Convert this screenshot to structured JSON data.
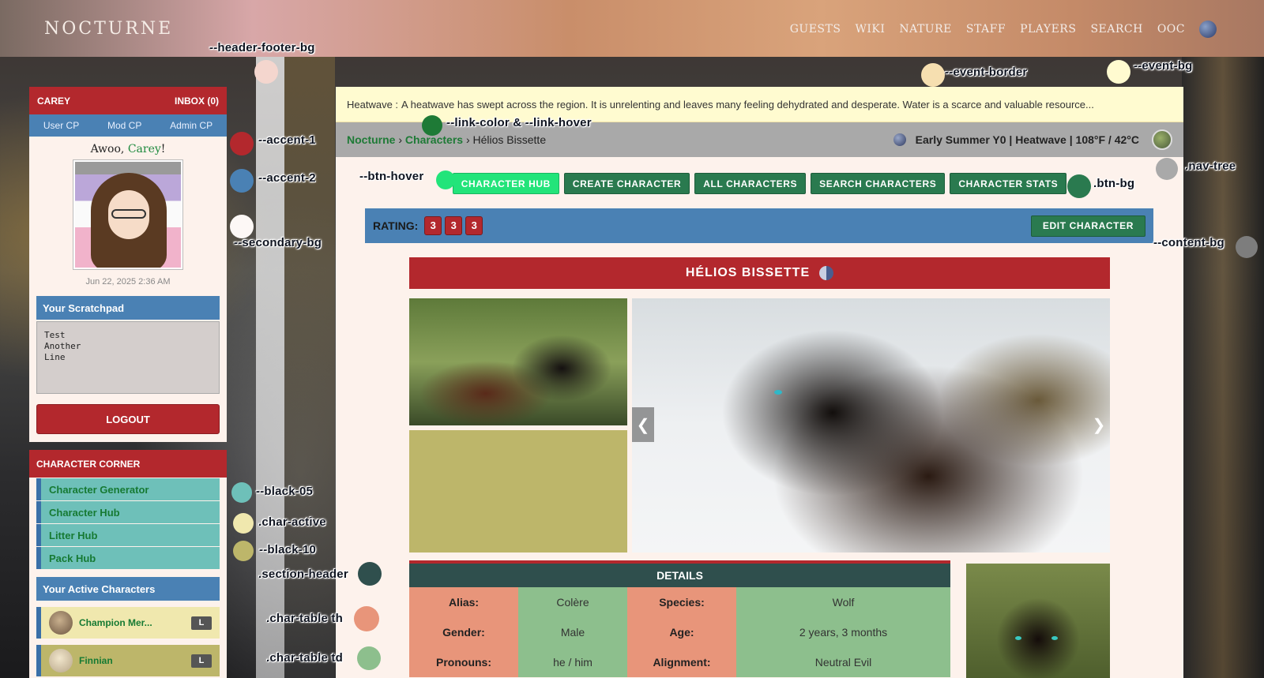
{
  "header": {
    "logo": "NOCTURNE",
    "nav": [
      "GUESTS",
      "WIKI",
      "NATURE",
      "STAFF",
      "PLAYERS",
      "SEARCH",
      "OOC"
    ]
  },
  "sidebar": {
    "user_name": "CAREY",
    "inbox": "INBOX (0)",
    "cp_links": [
      "User CP",
      "Mod CP",
      "Admin CP"
    ],
    "greeting_prefix": "Awoo, ",
    "greeting_name": "Carey",
    "greeting_suffix": "!",
    "date": "Jun 22, 2025 2:36 AM",
    "scratchpad_title": "Your Scratchpad",
    "scratchpad_text": "Test\nAnother\nLine",
    "logout": "LOGOUT",
    "corner_title": "CHARACTER CORNER",
    "corner_links": [
      "Character Generator",
      "Character Hub",
      "Litter Hub",
      "Pack Hub"
    ],
    "active_title": "Your Active Characters",
    "active_characters": [
      {
        "name": "Champion Mer...",
        "badge": "L"
      },
      {
        "name": "Finnian",
        "badge": "L"
      }
    ]
  },
  "event": {
    "label": "Heatwave :",
    "text": "A heatwave has swept across the region. It is unrelenting and leaves many feeling dehydrated and desperate. Water is a scarce and valuable resource..."
  },
  "breadcrumb": {
    "home": "Nocturne",
    "section": "Characters",
    "current": "Hélios Bissette",
    "sep": "›"
  },
  "weather": "Early Summer Y0 | Heatwave | 108°F / 42°C",
  "buttons": [
    "CHARACTER HUB",
    "CREATE CHARACTER",
    "ALL CHARACTERS",
    "SEARCH CHARACTERS",
    "CHARACTER STATS"
  ],
  "rating": {
    "label": "RATING:",
    "values": [
      "3",
      "3",
      "3"
    ],
    "edit": "EDIT CHARACTER"
  },
  "character": {
    "name": "HÉLIOS BISSETTE",
    "details_title": "DETAILS",
    "rows": [
      {
        "k1": "Alias:",
        "v1": "Colère",
        "k2": "Species:",
        "v2": "Wolf"
      },
      {
        "k1": "Gender:",
        "v1": "Male",
        "k2": "Age:",
        "v2": "2 years, 3 months"
      },
      {
        "k1": "Pronouns:",
        "v1": "he / him",
        "k2": "Alignment:",
        "v2": "Neutral Evil"
      }
    ]
  },
  "colors": {
    "accent_1": "#b3282d",
    "accent_2": "#4a81b4",
    "btn_bg": "#2a7a4f",
    "btn_hover": "#22e47a",
    "link_color": "#1e7a36",
    "event_bg": "#fffbd0",
    "event_border": "#f6dfb0",
    "content_bg": "#fdf2ec",
    "nav_tree": "#a9a9a9",
    "black_05": "#6ec0b9",
    "char_active": "#f0e8ae",
    "black_10": "#bdb66a",
    "section_header": "#2f4f4d",
    "char_table_th": "#e8957a",
    "char_table_td": "#8dbf8d",
    "secondary_bg": "#fdf8f6",
    "header_footer_bg": "#f4d6ce"
  },
  "annotations": {
    "header_footer_bg": "--header-footer-bg",
    "event_border": "--event-border",
    "event_bg": "--event-bg",
    "link": "--link-color & --link-hover",
    "accent_1": "--accent-1",
    "accent_2": "--accent-2",
    "secondary_bg": "--secondary-bg",
    "btn_hover": "--btn-hover",
    "btn_bg": ".btn-bg",
    "nav_tree": ".nav-tree",
    "content_bg": "--content-bg",
    "black_05": "--black-05",
    "char_active": ".char-active",
    "black_10": "--black-10",
    "section_header": ".section-header",
    "char_table_th": ".char-table th",
    "char_table_td": ".char-table td"
  }
}
